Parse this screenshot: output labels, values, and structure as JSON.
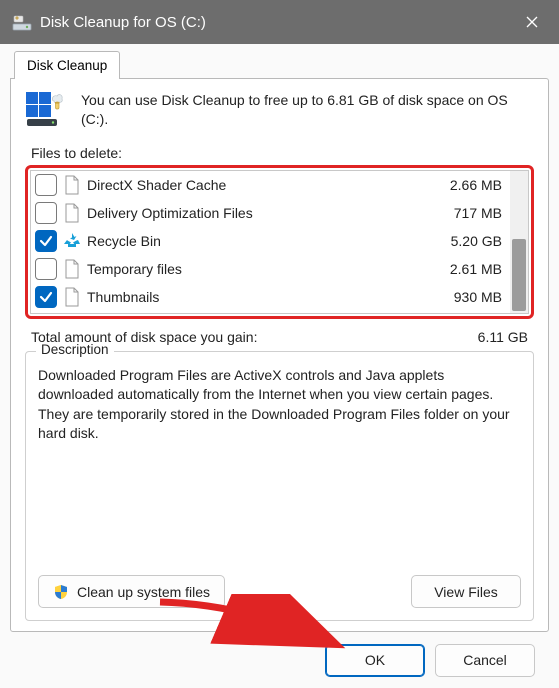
{
  "window": {
    "title": "Disk Cleanup for OS (C:)"
  },
  "tab": {
    "label": "Disk Cleanup"
  },
  "intro": {
    "text": "You can use Disk Cleanup to free up to 6.81 GB of disk space on OS (C:)."
  },
  "files_label": "Files to delete:",
  "rows": [
    {
      "label": "DirectX Shader Cache",
      "size": "2.66 MB",
      "checked": false,
      "icon": "file"
    },
    {
      "label": "Delivery Optimization Files",
      "size": "717 MB",
      "checked": false,
      "icon": "file"
    },
    {
      "label": "Recycle Bin",
      "size": "5.20 GB",
      "checked": true,
      "icon": "recycle"
    },
    {
      "label": "Temporary files",
      "size": "2.61 MB",
      "checked": false,
      "icon": "file"
    },
    {
      "label": "Thumbnails",
      "size": "930 MB",
      "checked": true,
      "icon": "file"
    }
  ],
  "total": {
    "label": "Total amount of disk space you gain:",
    "value": "6.11 GB"
  },
  "description": {
    "heading": "Description",
    "text": "Downloaded Program Files are ActiveX controls and Java applets downloaded automatically from the Internet when you view certain pages. They are temporarily stored in the Downloaded Program Files folder on your hard disk."
  },
  "buttons": {
    "clean_system": "Clean up system files",
    "view_files": "View Files",
    "ok": "OK",
    "cancel": "Cancel"
  }
}
